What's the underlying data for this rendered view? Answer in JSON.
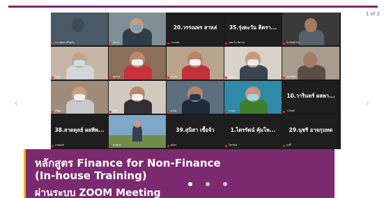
{
  "slide": {
    "counter": "1 of 2",
    "caption": {
      "line1": "หลักสูตร Finance for Non-Finance",
      "line2": "(In-house Training)",
      "line3": "ผ่านระบบ ZOOM Meeting"
    }
  },
  "zoom": {
    "tiles": [
      {
        "name": "น.ท.สุดสง ศรีสมใจ",
        "big": ""
      },
      {
        "name": "วิภาดา",
        "big": ""
      },
      {
        "name": "วรรณพร",
        "big": "20.วรรณพร สาหล่"
      },
      {
        "name": "รุ่งตะวัน ติดราม",
        "big": "35.รุ่งตะวัน ติดรา..."
      },
      {
        "name": "ประดิษฐ์ แก้ว",
        "big": ""
      },
      {
        "name": "นิตยา",
        "big": ""
      },
      {
        "name": "สุภาพร",
        "big": ""
      },
      {
        "name": "ธนากร",
        "big": ""
      },
      {
        "name": "บุษบา",
        "big": ""
      },
      {
        "name": "กมลทิพย์",
        "big": ""
      },
      {
        "name": "ศรีสุดา",
        "big": ""
      },
      {
        "name": "พัชรี",
        "big": ""
      },
      {
        "name": "มาลัย",
        "big": ""
      },
      {
        "name": "กานดา",
        "big": ""
      },
      {
        "name": "วารินทร์",
        "big": "10.วารินทร์ ผลพา..."
      },
      {
        "name": "ลาดดุลย์",
        "big": "38.ลาดดุลย์ ผลพีพ..."
      },
      {
        "name": "สายธาร",
        "big": ""
      },
      {
        "name": "สุนิสา",
        "big": "39.สุนิสา เชื้อจ้ว"
      },
      {
        "name": "ไตรรัตน์",
        "big": "1.ไตรรัตน์ คุ้มโพ..."
      },
      {
        "name": "นุชรี",
        "big": "29.นุชรี อาจกุนทด"
      }
    ]
  }
}
